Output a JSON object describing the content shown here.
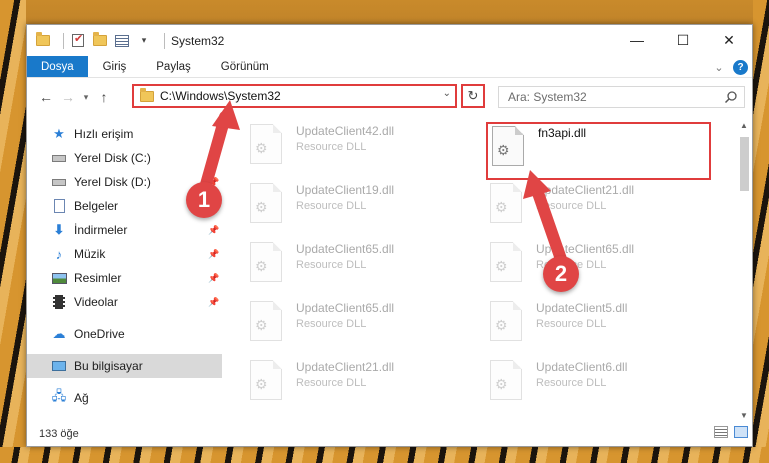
{
  "window": {
    "title": "System32",
    "controls": [
      "—",
      "☐",
      "✕"
    ]
  },
  "ribbon": {
    "tabs": [
      {
        "label": "Dosya",
        "active": true
      },
      {
        "label": "Giriş",
        "active": false
      },
      {
        "label": "Paylaş",
        "active": false
      },
      {
        "label": "Görünüm",
        "active": false
      }
    ],
    "help": "?"
  },
  "address": {
    "path": "C:\\Windows\\System32",
    "search_placeholder": "Ara: System32"
  },
  "sidebar": {
    "items": [
      {
        "label": "Hızlı erişim",
        "icon": "star-icon",
        "pinned": false
      },
      {
        "label": "Yerel Disk (C:)",
        "icon": "drive-icon",
        "pinned": true
      },
      {
        "label": "Yerel Disk (D:)",
        "icon": "drive-icon",
        "pinned": true
      },
      {
        "label": "Belgeler",
        "icon": "documents-icon",
        "pinned": true
      },
      {
        "label": "İndirmeler",
        "icon": "download-icon",
        "pinned": true
      },
      {
        "label": "Müzik",
        "icon": "music-icon",
        "pinned": true
      },
      {
        "label": "Resimler",
        "icon": "pictures-icon",
        "pinned": true
      },
      {
        "label": "Videolar",
        "icon": "videos-icon",
        "pinned": true
      },
      {
        "label": "OneDrive",
        "icon": "cloud-icon",
        "pinned": false
      },
      {
        "label": "Bu bilgisayar",
        "icon": "computer-icon",
        "pinned": false,
        "selected": true
      },
      {
        "label": "Ağ",
        "icon": "network-icon",
        "pinned": false
      }
    ]
  },
  "files": {
    "highlighted": {
      "name": "fn3api.dll",
      "type": ""
    },
    "left_column": [
      {
        "name": "UpdateClient42.dll",
        "type": "Resource DLL"
      },
      {
        "name": "UpdateClient19.dll",
        "type": "Resource DLL"
      },
      {
        "name": "UpdateClient65.dll",
        "type": "Resource DLL"
      },
      {
        "name": "UpdateClient65.dll",
        "type": "Resource DLL"
      },
      {
        "name": "UpdateClient21.dll",
        "type": "Resource DLL"
      }
    ],
    "right_column": [
      {
        "name": "UpdateClient21.dll",
        "type": "Resource DLL"
      },
      {
        "name": "UpdateClient65.dll",
        "type": "Resource DLL"
      },
      {
        "name": "UpdateClient5.dll",
        "type": "Resource DLL"
      },
      {
        "name": "UpdateClient6.dll",
        "type": "Resource DLL"
      }
    ]
  },
  "status": {
    "item_count": "133 öğe"
  },
  "annotations": {
    "step1": "1",
    "step2": "2"
  },
  "colors": {
    "accent": "#1979ca",
    "highlight_red": "#e03c3c"
  }
}
